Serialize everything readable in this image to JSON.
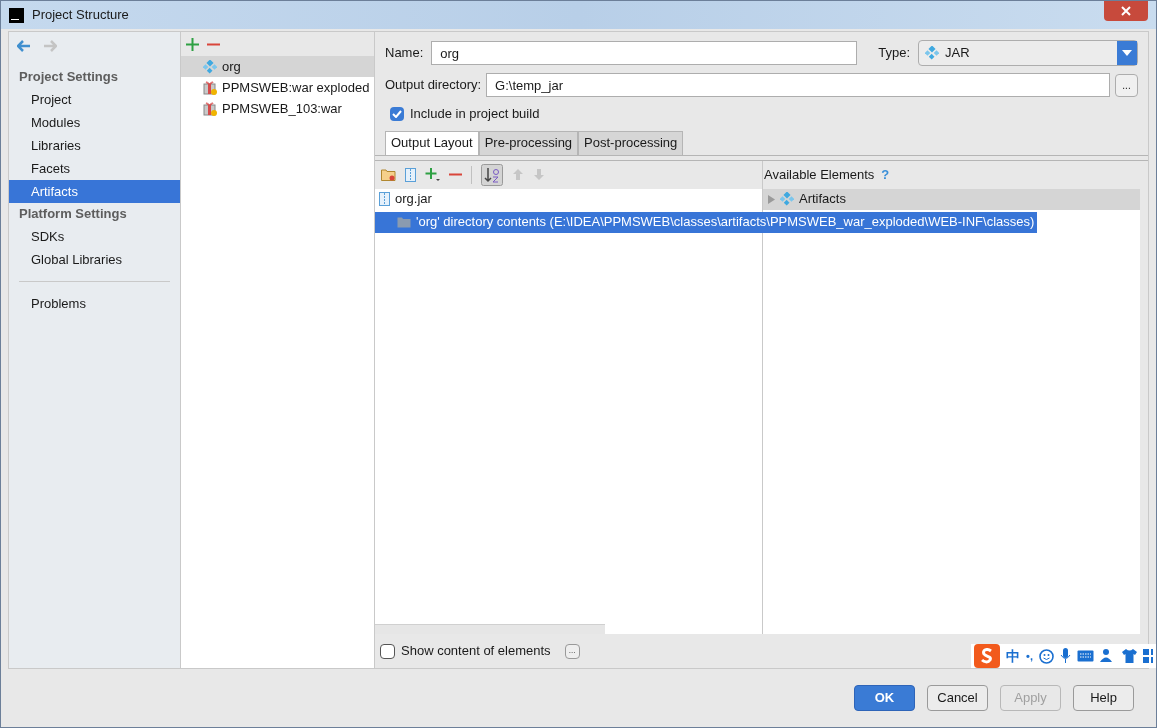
{
  "window": {
    "title": "Project Structure"
  },
  "sidebar": {
    "sections": [
      {
        "heading": "Project Settings",
        "items": [
          {
            "label": "Project",
            "selected": false
          },
          {
            "label": "Modules",
            "selected": false
          },
          {
            "label": "Libraries",
            "selected": false
          },
          {
            "label": "Facets",
            "selected": false
          },
          {
            "label": "Artifacts",
            "selected": true
          }
        ]
      },
      {
        "heading": "Platform Settings",
        "items": [
          {
            "label": "SDKs",
            "selected": false
          },
          {
            "label": "Global Libraries",
            "selected": false
          }
        ]
      }
    ],
    "bottom_items": [
      {
        "label": "Problems",
        "selected": false
      }
    ]
  },
  "artifact_list": {
    "items": [
      {
        "label": "org",
        "kind": "jar",
        "selected": true
      },
      {
        "label": "PPMSWEB:war exploded",
        "kind": "war",
        "selected": false
      },
      {
        "label": "PPMSWEB_103:war",
        "kind": "war",
        "selected": false
      }
    ]
  },
  "form": {
    "name_label": "Name:",
    "name_value": "org",
    "type_label": "Type:",
    "type_value": "JAR",
    "output_label": "Output directory:",
    "output_value": "G:\\temp_jar",
    "browse": "...",
    "include_build": {
      "label": "Include in project build",
      "checked": true
    }
  },
  "tabs": [
    {
      "label": "Output Layout",
      "selected": true
    },
    {
      "label": "Pre-processing",
      "selected": false
    },
    {
      "label": "Post-processing",
      "selected": false
    }
  ],
  "layout_tree": {
    "items": [
      {
        "label": "org.jar",
        "kind": "jar",
        "selected": false
      },
      {
        "label": "'org' directory contents (E:\\IDEA\\PPMSWEB\\classes\\artifacts\\PPMSWEB_war_exploded\\WEB-INF\\classes)",
        "kind": "directory",
        "selected": true
      }
    ]
  },
  "available": {
    "title": "Available Elements",
    "help": "?",
    "items": [
      {
        "label": "Artifacts",
        "expanded": false
      }
    ]
  },
  "show_content": {
    "label": "Show content of elements",
    "checked": false,
    "more": "..."
  },
  "ime_bar": {
    "text": "中",
    "punct": "•,"
  },
  "buttons": [
    {
      "label": "OK",
      "kind": "primary"
    },
    {
      "label": "Cancel",
      "kind": "normal"
    },
    {
      "label": "Apply",
      "kind": "disabled"
    },
    {
      "label": "Help",
      "kind": "normal"
    }
  ]
}
